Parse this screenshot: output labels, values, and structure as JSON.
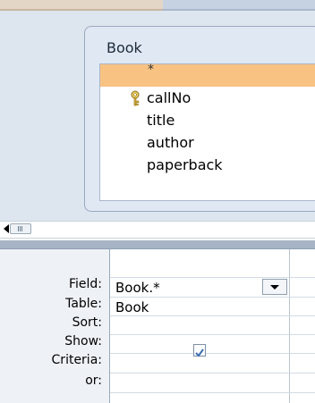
{
  "table": {
    "title": "Book",
    "fields": [
      {
        "label": "*",
        "selected": true
      },
      {
        "label": "callNo",
        "primary_key": true
      },
      {
        "label": "title"
      },
      {
        "label": "author"
      },
      {
        "label": "paperback"
      }
    ]
  },
  "grid": {
    "row_labels": [
      "Field:",
      "Table:",
      "Sort:",
      "Show:",
      "Criteria:",
      "or:"
    ],
    "column": {
      "field": "Book.*",
      "table": "Book",
      "sort": "",
      "show": true,
      "criteria": "",
      "or": ""
    }
  },
  "colors": {
    "selected_row": "#f8c283",
    "pane_background": "#dde5ef"
  },
  "icons": {
    "primary_key": "key-icon",
    "dropdown": "chevron-down-icon",
    "scroll_left": "arrow-left-icon",
    "checkbox": "checkmark-icon"
  }
}
